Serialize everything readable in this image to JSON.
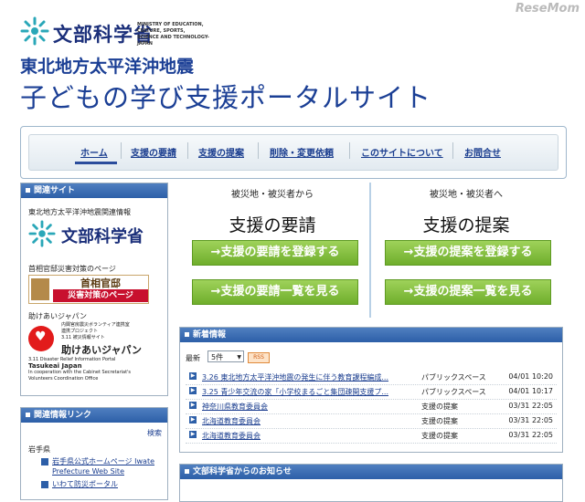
{
  "watermark": "ReseMom",
  "header": {
    "ministry": "文部科学省",
    "ministry_en_1": "MINISTRY OF EDUCATION,",
    "ministry_en_2": "CULTURE, SPORTS,",
    "ministry_en_3": "SCIENCE AND TECHNOLOGY-JAPAN",
    "title_line1": "東北地方太平洋沖地震",
    "title_line2": "子どもの学び支援ポータルサイト"
  },
  "nav": [
    "ホーム",
    "支援の要請",
    "支援の提案",
    "削除・変更依頼",
    "このサイトについて",
    "お問合せ"
  ],
  "sidebar": {
    "related_head": "関連サイト",
    "earthquake_info": "東北地方太平洋沖地震関連情報",
    "mext_logo_text": "文部科学省",
    "kantei_caption": "首相官邸災害対策のページ",
    "kantei_name": "首相官邸",
    "kantei_sub": "災害対策のページ",
    "tasukeai_caption": "助けあいジャパン",
    "tasukeai_small_1": "内閣官房震災ボランティア連携室",
    "tasukeai_small_2": "連携プロジェクト",
    "tasukeai_small_3": "3.11 被災情報サイト",
    "tasukeai_name": "助けあいジャパン",
    "tasukeai_en_1": "3.11 Disaster Relief Information Portal",
    "tasukeai_en_2": "Tasukeai Japan",
    "tasukeai_en_3": "In cooperation with the Cabinet Secretariat's",
    "tasukeai_en_4": "Volunteers Coordination Office",
    "links_head": "関連情報リンク",
    "search_label": "検索",
    "pref": "岩手県",
    "link1a": "岩手県公式ホームページ Iwate",
    "link1b": "Prefecture Web Site",
    "link2": "いわて防災ポータル"
  },
  "panels": {
    "left_caption": "被災地・被災者から",
    "left_title": "支援の要請",
    "left_btn1": "→支援の要請を登録する",
    "left_btn2": "→支援の要請一覧を見る",
    "right_caption": "被災地・被災者へ",
    "right_title": "支援の提案",
    "right_btn1": "→支援の提案を登録する",
    "right_btn2": "→支援の提案一覧を見る"
  },
  "news": {
    "head": "新着情報",
    "latest_label": "最新",
    "count_value": "5件",
    "rss": "RSS",
    "rows": [
      {
        "title": "3.26 東北地方太平洋沖地震の発生に伴う教育課程編成...",
        "category": "パブリックスペース",
        "date": "04/01 10:20"
      },
      {
        "title": "3.25 青少年交流の家「小学校まるごと集団疎開支援プ...",
        "category": "パブリックスペース",
        "date": "04/01 10:17"
      },
      {
        "title": "神奈川県教育委員会",
        "category": "支援の提案",
        "date": "03/31 22:05"
      },
      {
        "title": "北海道教育委員会",
        "category": "支援の提案",
        "date": "03/31 22:05"
      },
      {
        "title": "北海道教育委員会",
        "category": "支援の提案",
        "date": "03/31 22:05"
      }
    ]
  },
  "notice": {
    "head": "文部科学省からのお知らせ"
  },
  "colors": {
    "brand_blue": "#1b3f95",
    "header_bar": "#2d5fa8",
    "button_green": "#7cbb35"
  }
}
